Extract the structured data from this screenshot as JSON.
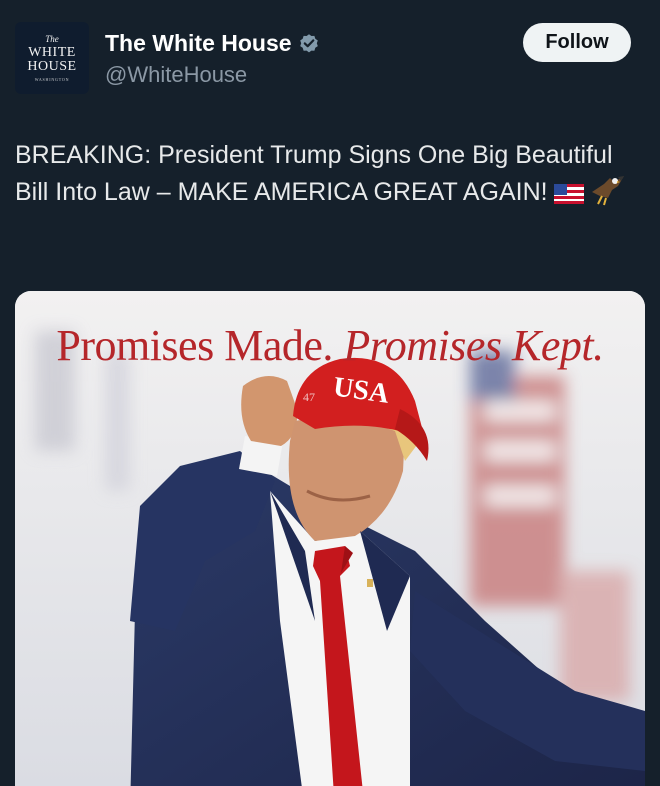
{
  "account": {
    "avatar": {
      "small": "The",
      "line1": "WHITE",
      "line2": "HOUSE",
      "sub": "WASHINGTON"
    },
    "display_name": "The White House",
    "verified": true,
    "handle": "@WhiteHouse",
    "follow_label": "Follow"
  },
  "tweet": {
    "text": "BREAKING: President Trump Signs One Big Beautiful Bill Into Law – MAKE AMERICA GREAT AGAIN!",
    "emojis": [
      "us-flag-emoji",
      "eagle-emoji"
    ]
  },
  "media": {
    "headline_plain": "Promises Made.",
    "headline_italic": "Promises Kept.",
    "hat_text": "USA",
    "hat_number": "47"
  },
  "colors": {
    "background": "#15202b",
    "follow_button": "#eff3f4",
    "headline_red": "#b5262a",
    "verified_badge": "#829aab"
  }
}
